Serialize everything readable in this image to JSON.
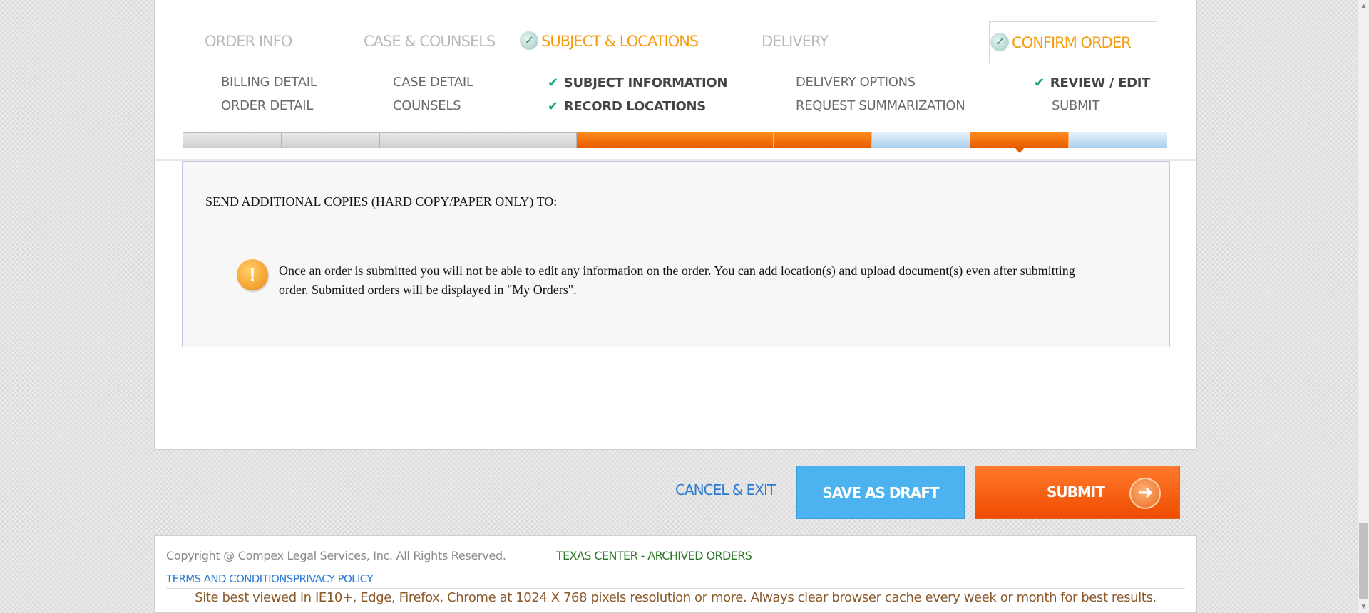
{
  "tabs": {
    "order_info": "ORDER INFO",
    "case_counsels": "CASE & COUNSELS",
    "subject_locations": "SUBJECT & LOCATIONS",
    "delivery": "DELIVERY",
    "confirm_order": "CONFIRM ORDER"
  },
  "subnav": {
    "billing_detail": "BILLING DETAIL",
    "order_detail": "ORDER DETAIL",
    "case_detail": "CASE DETAIL",
    "counsels": "COUNSELS",
    "subject_information": "SUBJECT INFORMATION",
    "record_locations": "RECORD LOCATIONS",
    "delivery_options": "DELIVERY OPTIONS",
    "request_summarization": "REQUEST SUMMARIZATION",
    "review_edit": "REVIEW / EDIT",
    "submit": "SUBMIT"
  },
  "progress": {
    "segments": [
      "gray",
      "gray",
      "gray",
      "gray",
      "orange",
      "orange",
      "orange",
      "blue",
      "orange",
      "blue"
    ],
    "current_index": 8
  },
  "content": {
    "send_additional": "SEND ADDITIONAL COPIES (HARD COPY/PAPER ONLY) TO:",
    "notice": "Once an order is submitted you will not be able to edit any information on the order. You can add location(s) and upload document(s) even after submitting order. Submitted orders will be displayed in \"My Orders\"."
  },
  "actions": {
    "cancel_exit": "CANCEL & EXIT",
    "save_as_draft": "SAVE AS DRAFT",
    "submit": "SUBMIT"
  },
  "footer": {
    "copyright": "Copyright @ Compex Legal Services, Inc. All Rights Reserved.",
    "texas_center": "TEXAS CENTER - ARCHIVED ORDERS",
    "terms": "TERMS AND CONDITIONS",
    "privacy": "PRIVACY POLICY",
    "note": "Site best viewed in IE10+, Edge, Firefox, Chrome at 1024 X 768 pixels resolution or more. Always clear browser cache every week or month for best results."
  },
  "icons": {
    "check_badge": "check-circle-icon",
    "tick": "checkmark-icon",
    "notice": "exclamation-icon",
    "submit_arrow": "arrow-right-icon"
  },
  "colors": {
    "accent_orange": "#f79a0b",
    "submit_orange": "#ee4c00",
    "draft_blue": "#4cb3f0",
    "link_blue": "#2b7bd4",
    "check_green": "#1aa37a"
  }
}
